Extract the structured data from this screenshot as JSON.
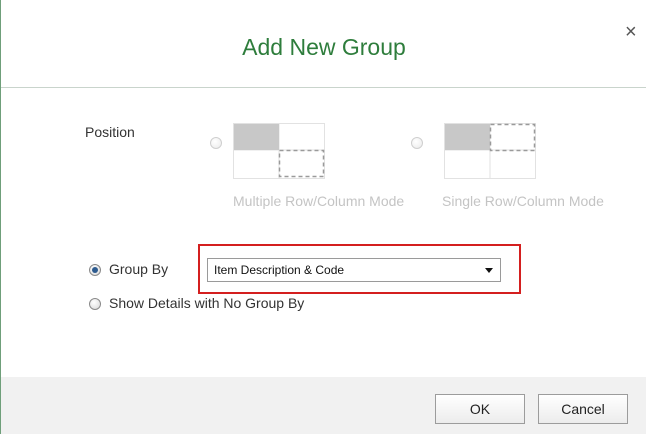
{
  "dialog": {
    "title": "Add New Group",
    "close_glyph": "×"
  },
  "position": {
    "label": "Position",
    "modes": [
      {
        "label": "Multiple Row/Column Mode",
        "icon": "multiple-row-column-icon",
        "enabled": false
      },
      {
        "label": "Single Row/Column Mode",
        "icon": "single-row-column-icon",
        "enabled": false
      }
    ]
  },
  "grouping": {
    "group_by_label": "Group By",
    "group_by_selected": true,
    "group_by_value": "Item Description & Code",
    "no_group_label": "Show Details with No Group By",
    "no_group_selected": false
  },
  "footer": {
    "ok_label": "OK",
    "cancel_label": "Cancel"
  },
  "colors": {
    "title": "#2e7d3c",
    "highlight": "#d41f1f",
    "radio_dot": "#2d5b8f",
    "disabled_text": "#c4c4c4"
  }
}
